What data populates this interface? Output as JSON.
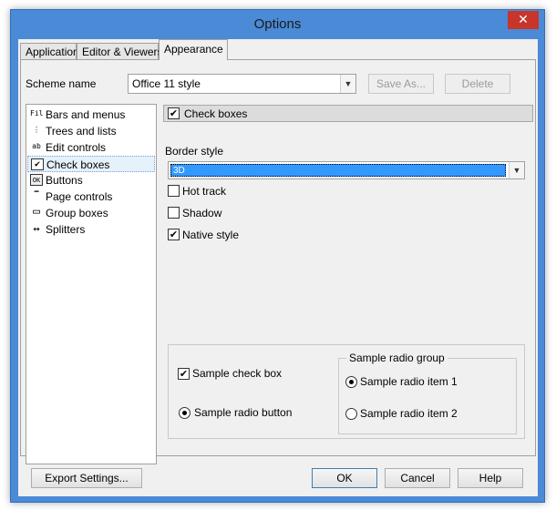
{
  "window": {
    "title": "Options",
    "close_glyph": "✕"
  },
  "tabs": [
    {
      "label": "Application",
      "active": false
    },
    {
      "label": "Editor & Viewers",
      "active": false
    },
    {
      "label": "Appearance",
      "active": true
    }
  ],
  "scheme": {
    "label": "Scheme name",
    "value": "Office 11 style",
    "save_as_label": "Save As...",
    "delete_label": "Delete"
  },
  "tree": {
    "items": [
      {
        "label": "Bars and menus",
        "icon": "bars-menus-icon",
        "glyph": "Fil"
      },
      {
        "label": "Trees and lists",
        "icon": "tree-list-icon",
        "glyph": "⋮"
      },
      {
        "label": "Edit controls",
        "icon": "edit-control-icon",
        "glyph": "ab"
      },
      {
        "label": "Check boxes",
        "icon": "checkbox-icon",
        "glyph": "✔",
        "selected": true
      },
      {
        "label": "Buttons",
        "icon": "button-icon",
        "glyph": "OK"
      },
      {
        "label": "Page controls",
        "icon": "page-control-icon",
        "glyph": "▔"
      },
      {
        "label": "Group boxes",
        "icon": "group-box-icon",
        "glyph": "▭"
      },
      {
        "label": "Splitters",
        "icon": "splitter-icon",
        "glyph": "↔"
      }
    ]
  },
  "panel": {
    "header_label": "Check boxes",
    "header_checked": true,
    "border_style_label": "Border style",
    "border_style_value": "3D",
    "options": [
      {
        "label": "Hot track",
        "checked": false
      },
      {
        "label": "Shadow",
        "checked": false
      },
      {
        "label": "Native style",
        "checked": true
      }
    ]
  },
  "sample": {
    "checkbox_label": "Sample check box",
    "checkbox_checked": true,
    "radio_label": "Sample radio button",
    "radio_checked": true,
    "group_caption": "Sample radio group",
    "group_items": [
      {
        "label": "Sample radio item 1",
        "checked": true
      },
      {
        "label": "Sample radio item 2",
        "checked": false
      }
    ]
  },
  "footer": {
    "export_label": "Export Settings...",
    "ok_label": "OK",
    "cancel_label": "Cancel",
    "help_label": "Help"
  },
  "glyphs": {
    "check": "✔",
    "dropdown": "▼"
  }
}
